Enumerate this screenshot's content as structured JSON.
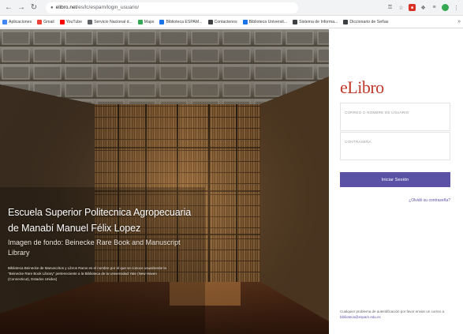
{
  "browser": {
    "url_host": "elibro.net",
    "url_path": "/es/lc/espam/login_usuario/",
    "bookmarks": [
      {
        "label": "Aplicaciones",
        "color": "#4285f4"
      },
      {
        "label": "Gmail",
        "color": "#ea4335"
      },
      {
        "label": "YouTube",
        "color": "#ff0000"
      },
      {
        "label": "Servicio Nacional d...",
        "color": "#5f6368"
      },
      {
        "label": "Maps",
        "color": "#34a853"
      },
      {
        "label": "Biblioteca ESPAM...",
        "color": "#1a73e8"
      },
      {
        "label": "Contactenos",
        "color": "#3c4043"
      },
      {
        "label": "Biblioteca Universit...",
        "color": "#1a73e8"
      },
      {
        "label": "Sistema de Informa...",
        "color": "#3c4043"
      },
      {
        "label": "Diccionario de Señas",
        "color": "#3c4043"
      }
    ]
  },
  "hero": {
    "institution_name": "Escuela Superior Politecnica Agropecuaria de Manabí Manuel Félix Lopez",
    "image_credit": "Imagen de fondo: Beinecke Rare Book and Manuscript Library",
    "description": "Biblioteca Beinecke de Manuscritos y Libros Raros es el nombre por el que se conoce usualmente la \"Beinecke Rare Book Library\" perteneciente a la Biblioteca de la Universidad Yale (New Haven (Connecticut), Estados Unidos)"
  },
  "login": {
    "logo": "eLibro",
    "username_placeholder": "CORREO O NOMBRE DE USUARIO",
    "password_placeholder": "CONTRASEÑA",
    "submit_label": "Iniciar Sesión",
    "forgot_label": "¿Olvidó su contraseña?",
    "support_text": "Cualquier problema de autentificación por favor enviar un correo a",
    "support_email": "biblioteca@espam.edu.ec"
  },
  "colors": {
    "brand_red": "#c0392b",
    "button_purple": "#5b52a6"
  }
}
